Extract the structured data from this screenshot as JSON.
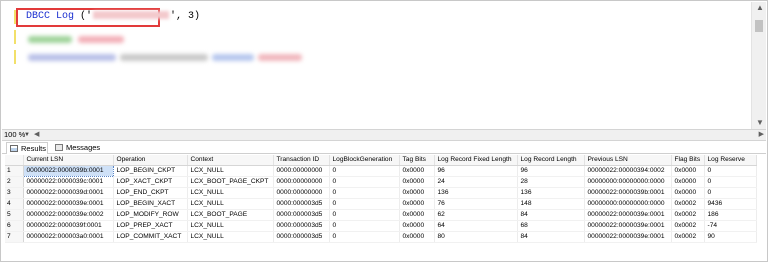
{
  "editor": {
    "keyword": "DBCC Log",
    "arg_open": " ('",
    "arg_close": "', 3)"
  },
  "zoom": {
    "level": "100 %"
  },
  "tabs": [
    {
      "label": "Results"
    },
    {
      "label": "Messages"
    }
  ],
  "results": {
    "columns": [
      "Current LSN",
      "Operation",
      "Context",
      "Transaction ID",
      "LogBlockGeneration",
      "Tag Bits",
      "Log Record Fixed Length",
      "Log Record Length",
      "Previous LSN",
      "Flag Bits",
      "Log Reserve"
    ],
    "rows": [
      [
        "1",
        "00000022:0000039b:0001",
        "LOP_BEGIN_CKPT",
        "LCX_NULL",
        "0000:00000000",
        "0",
        "0x0000",
        "96",
        "96",
        "00000022:00000394:0002",
        "0x0000",
        "0"
      ],
      [
        "2",
        "00000022:0000039c:0001",
        "LOP_XACT_CKPT",
        "LCX_BOOT_PAGE_CKPT",
        "0000:00000000",
        "0",
        "0x0000",
        "24",
        "28",
        "00000000:00000000:0000",
        "0x0000",
        "0"
      ],
      [
        "3",
        "00000022:0000039d:0001",
        "LOP_END_CKPT",
        "LCX_NULL",
        "0000:00000000",
        "0",
        "0x0000",
        "136",
        "136",
        "00000022:0000039b:0001",
        "0x0000",
        "0"
      ],
      [
        "4",
        "00000022:0000039e:0001",
        "LOP_BEGIN_XACT",
        "LCX_NULL",
        "0000:000003d5",
        "0",
        "0x0000",
        "76",
        "148",
        "00000000:00000000:0000",
        "0x0002",
        "9436"
      ],
      [
        "5",
        "00000022:0000039e:0002",
        "LOP_MODIFY_ROW",
        "LCX_BOOT_PAGE",
        "0000:000003d5",
        "0",
        "0x0000",
        "62",
        "84",
        "00000022:0000039e:0001",
        "0x0002",
        "186"
      ],
      [
        "6",
        "00000022:0000039f:0001",
        "LOP_PREP_XACT",
        "LCX_NULL",
        "0000:000003d5",
        "0",
        "0x0000",
        "64",
        "68",
        "00000022:0000039e:0001",
        "0x0002",
        "-74"
      ],
      [
        "7",
        "00000022:000003a0:0001",
        "LOP_COMMIT_XACT",
        "LCX_NULL",
        "0000:000003d5",
        "0",
        "0x0000",
        "80",
        "84",
        "00000022:0000039e:0001",
        "0x0002",
        "90"
      ]
    ]
  },
  "colors": {
    "highlight_border": "#e23a3a",
    "keyword": "#1a2fd0",
    "string": "#c8102e",
    "selected_cell": "#cfe1f7"
  },
  "icons": [
    "results-grid-icon",
    "messages-icon",
    "dropdown-caret-icon",
    "scroll-up-icon",
    "scroll-down-icon",
    "scroll-left-icon",
    "scroll-right-icon"
  ]
}
